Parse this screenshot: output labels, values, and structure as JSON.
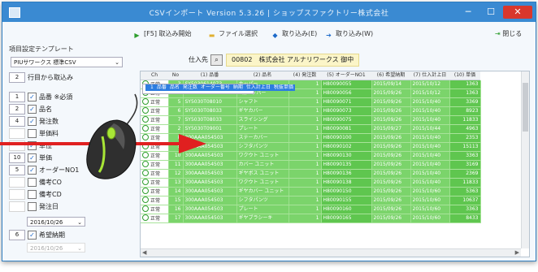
{
  "window": {
    "title": "CSVインポート Version 5.3.26 | ショップスファクトリー株式会社",
    "min_glyph": "─",
    "max_glyph": "☐",
    "close_glyph": "✕"
  },
  "toolbar": {
    "buttons": [
      {
        "label": "[F5] 取込み開始",
        "icon": "play-icon",
        "color": "#2e9e2e",
        "glyph": "▶"
      },
      {
        "label": "ファイル選択",
        "icon": "folder-icon",
        "color": "#e0b030",
        "glyph": "▬"
      },
      {
        "label": "取り込み(E)",
        "icon": "import-arrow-icon",
        "color": "#1d6ac9",
        "glyph": "◆"
      },
      {
        "label": "取り込み(W)",
        "icon": "import-arrow-icon",
        "color": "#1d6ac9",
        "glyph": "➔"
      }
    ],
    "close_label": "閉じる",
    "close_icon_glyph": "⇥"
  },
  "left_panel": {
    "template_label": "項目設定テンプレート",
    "template_value": "PIUサワークス 標準CSV",
    "select_arrow": "⌄",
    "header_label": "行目から取込み",
    "header_value": "2",
    "check_glyph": "✓",
    "fields": [
      {
        "num": "1",
        "checked": true,
        "label": "品番 ※必須"
      },
      {
        "num": "2",
        "checked": true,
        "label": "品名"
      },
      {
        "num": "4",
        "checked": true,
        "label": "発注数"
      },
      {
        "num": "",
        "checked": false,
        "label": "単価料"
      },
      {
        "num": "",
        "checked": true,
        "label": "単位"
      },
      {
        "num": "10",
        "checked": true,
        "label": "単価"
      },
      {
        "num": "5",
        "checked": true,
        "label": "オーダーNO1"
      },
      {
        "num": "",
        "checked": false,
        "label": "備考CO"
      },
      {
        "num": "",
        "checked": false,
        "label": "備考CD"
      },
      {
        "num": "",
        "checked": false,
        "label": "発注日"
      }
    ],
    "date1": "2016/10/26",
    "delivery_num": "6",
    "delivery_label": "希望納期",
    "date2": "2016/10/26"
  },
  "supplier": {
    "label": "仕入先",
    "code": "00802",
    "name": "株式会社 アルナリワークス 御中"
  },
  "grid": {
    "columns": [
      "Ch",
      "No",
      "(1) 品番",
      "(2) 品名",
      "(4) 発注数",
      "(5) オーダーNO1",
      "(6) 希望納期",
      "(7) 仕入計上日",
      "(10) 単価"
    ],
    "rows": [
      {
        "status": "",
        "no": "1",
        "code": "品番",
        "name": "品名",
        "qty": "発注数",
        "order": "オーダー番号",
        "due": "納期",
        "date": "仕入計上日",
        "price": "税抜単価",
        "selected": true
      },
      {
        "status": "正常",
        "no": "3",
        "code": "SY5030614073",
        "name": "ホッパー",
        "qty": "1",
        "order": "H80090055",
        "due": "2015/09/14",
        "date": "2015/10/12",
        "price": "1363"
      },
      {
        "status": "正常",
        "no": "4",
        "code": "SY5030107061",
        "name": "1段ホッパー",
        "qty": "1",
        "order": "H80090056",
        "due": "2015/09/26",
        "date": "2015/10/12",
        "price": "1363"
      },
      {
        "status": "正常",
        "no": "5",
        "code": "SY5030T08010",
        "name": "シャフト",
        "qty": "1",
        "order": "H80090071",
        "due": "2015/09/26",
        "date": "2015/10/40",
        "price": "3369"
      },
      {
        "status": "正常",
        "no": "6",
        "code": "SY5030T08033",
        "name": "ギヤカバー",
        "qty": "1",
        "order": "H80090073",
        "due": "2015/09/26",
        "date": "2015/10/40",
        "price": "8923"
      },
      {
        "status": "正常",
        "no": "7",
        "code": "SY5030T08033",
        "name": "スライシング",
        "qty": "1",
        "order": "H80090075",
        "due": "2015/09/26",
        "date": "2015/10/40",
        "price": "11833"
      },
      {
        "status": "正常",
        "no": "2",
        "code": "SY5030T09001",
        "name": "プレート",
        "qty": "1",
        "order": "H80090081",
        "due": "2015/09/27",
        "date": "2015/10/44",
        "price": "4963"
      },
      {
        "status": "正常",
        "no": "8",
        "code": "300AAA054503",
        "name": "ステーカバー",
        "qty": "1",
        "order": "H80090100",
        "due": "2015/09/26",
        "date": "2015/10/40",
        "price": "2353"
      },
      {
        "status": "正常",
        "no": "9",
        "code": "300AAA054503",
        "name": "シフタパンツ",
        "qty": "1",
        "order": "H80090102",
        "due": "2015/09/26",
        "date": "2015/10/40",
        "price": "15113"
      },
      {
        "status": "正常",
        "no": "10",
        "code": "300AAA054503",
        "name": "ワクウト ユニット",
        "qty": "1",
        "order": "H80090130",
        "due": "2015/09/26",
        "date": "2015/10/40",
        "price": "3363"
      },
      {
        "status": "正常",
        "no": "11",
        "code": "300AAA054503",
        "name": "カバー ユニット",
        "qty": "1",
        "order": "H80090135",
        "due": "2015/09/26",
        "date": "2015/10/40",
        "price": "3169"
      },
      {
        "status": "正常",
        "no": "12",
        "code": "300AAA054503",
        "name": "ギヤボス ユニット",
        "qty": "1",
        "order": "H80090136",
        "due": "2015/09/26",
        "date": "2015/10/40",
        "price": "2369"
      },
      {
        "status": "正常",
        "no": "13",
        "code": "300AAA054503",
        "name": "ワクウト ユニット",
        "qty": "1",
        "order": "H80090138",
        "due": "2015/09/26",
        "date": "2015/10/40",
        "price": "11833"
      },
      {
        "status": "正常",
        "no": "14",
        "code": "300AAA054503",
        "name": "ギヤカバー ユニット",
        "qty": "1",
        "order": "H80090150",
        "due": "2015/09/26",
        "date": "2015/10/60",
        "price": "5363"
      },
      {
        "status": "正常",
        "no": "15",
        "code": "300AAA054503",
        "name": "シフタパンツ",
        "qty": "1",
        "order": "H80090155",
        "due": "2015/09/26",
        "date": "2015/10/60",
        "price": "10637"
      },
      {
        "status": "正常",
        "no": "16",
        "code": "300AAA054503",
        "name": "プレート",
        "qty": "1",
        "order": "H80090160",
        "due": "2015/09/26",
        "date": "2015/10/60",
        "price": "3363"
      },
      {
        "status": "正常",
        "no": "17",
        "code": "300AAA054503",
        "name": "ギヤブラシーキ",
        "qty": "1",
        "order": "H80090165",
        "due": "2015/09/26",
        "date": "2015/10/60",
        "price": "8433"
      }
    ],
    "scroll_left_glyph": "◀",
    "scroll_right_glyph": "▶",
    "scroll_up_glyph": "▲",
    "scroll_down_glyph": "▼"
  },
  "colors": {
    "title_bar": "#3a8ad2",
    "row_green": "#7bd46b",
    "selected_row": "#2d7de0",
    "arrow": "#e02020"
  }
}
